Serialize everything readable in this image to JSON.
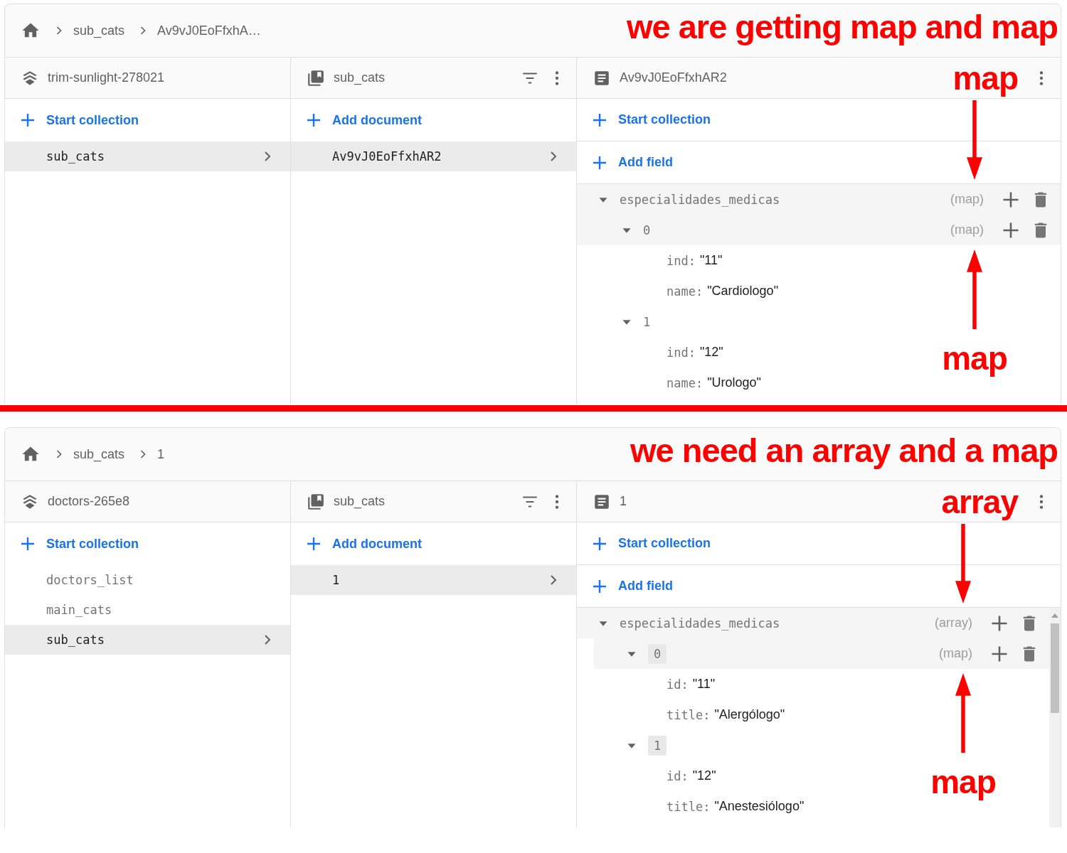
{
  "panels": [
    {
      "breadcrumb": [
        "sub_cats",
        "Av9vJ0EoFfxhA…"
      ],
      "annotation_title": "we are getting map and map",
      "root": {
        "title": "trim-sunlight-278021",
        "action": "Start collection",
        "items": [
          {
            "label": "sub_cats",
            "selected": true
          }
        ]
      },
      "collection": {
        "title": "sub_cats",
        "action": "Add document",
        "items": [
          {
            "label": "Av9vJ0EoFfxhAR2",
            "selected": true
          }
        ]
      },
      "document": {
        "title": "Av9vJ0EoFfxhAR2",
        "annotation_label": "map",
        "actions": [
          "Start collection",
          "Add field"
        ],
        "arrows": [
          {
            "kind": "down"
          },
          {
            "kind": "up",
            "label": "map"
          }
        ],
        "fields": [
          {
            "key": "especialidades_medicas",
            "type": "(map)",
            "highlighted": true,
            "expanded": true,
            "boxed": false,
            "children": [
              {
                "key": "0",
                "type": "(map)",
                "highlighted": true,
                "expanded": true,
                "boxed": false,
                "children": [
                  {
                    "key": "ind:",
                    "value": "\"11\""
                  },
                  {
                    "key": "name:",
                    "value": "\"Cardiologo\""
                  }
                ]
              },
              {
                "key": "1",
                "highlighted": false,
                "expanded": true,
                "boxed": false,
                "children": [
                  {
                    "key": "ind:",
                    "value": "\"12\""
                  },
                  {
                    "key": "name:",
                    "value": "\"Urologo\""
                  }
                ]
              }
            ]
          }
        ]
      }
    },
    {
      "breadcrumb": [
        "sub_cats",
        "1"
      ],
      "annotation_title": "we need an array and a map",
      "root": {
        "title": "doctors-265e8",
        "action": "Start collection",
        "items": [
          {
            "label": "doctors_list",
            "selected": false
          },
          {
            "label": "main_cats",
            "selected": false
          },
          {
            "label": "sub_cats",
            "selected": true
          }
        ]
      },
      "collection": {
        "title": "sub_cats",
        "action": "Add document",
        "items": [
          {
            "label": "1",
            "selected": true
          }
        ]
      },
      "document": {
        "title": "1",
        "annotation_label": "array",
        "actions": [
          "Start collection",
          "Add field"
        ],
        "scrollbar": true,
        "arrows": [
          {
            "kind": "down"
          },
          {
            "kind": "up",
            "label": "map"
          }
        ],
        "fields": [
          {
            "key": "especialidades_medicas",
            "type": "(array)",
            "highlighted": true,
            "expanded": true,
            "boxed": false,
            "children": [
              {
                "key": "0",
                "type": "(map)",
                "highlighted": true,
                "expanded": true,
                "boxed": true,
                "children": [
                  {
                    "key": "id:",
                    "value": "\"11\""
                  },
                  {
                    "key": "title:",
                    "value": "\"Alergólogo\""
                  }
                ]
              },
              {
                "key": "1",
                "highlighted": false,
                "expanded": true,
                "boxed": true,
                "children": [
                  {
                    "key": "id:",
                    "value": "\"12\""
                  },
                  {
                    "key": "title:",
                    "value": "\"Anestesiólogo\""
                  }
                ]
              }
            ]
          }
        ]
      }
    }
  ]
}
